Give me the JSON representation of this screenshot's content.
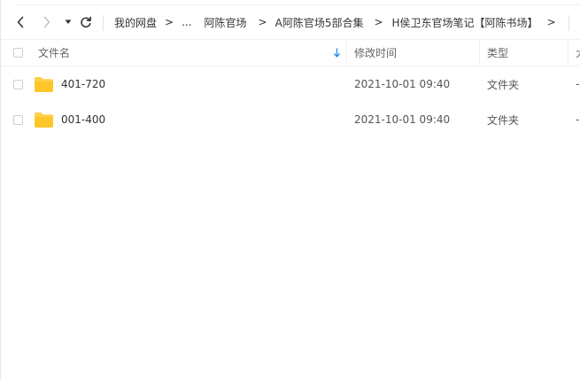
{
  "breadcrumb": {
    "items": [
      "我的网盘",
      "...",
      "阿陈官场",
      "A阿陈官场5部合集",
      "H侯卫东官场笔记【阿陈书场】"
    ],
    "separator": ">"
  },
  "columns": {
    "name": "文件名",
    "modified": "修改时间",
    "type": "类型",
    "size": "大"
  },
  "files": [
    {
      "name": "401-720",
      "modified": "2021-10-01 09:40",
      "type": "文件夹",
      "size": "-"
    },
    {
      "name": "001-400",
      "modified": "2021-10-01 09:40",
      "type": "文件夹",
      "size": "-"
    }
  ],
  "icons": {
    "back": "chevron-left-icon",
    "forward": "chevron-right-icon",
    "history": "caret-down-icon",
    "refresh": "refresh-icon",
    "folder": "folder-icon",
    "sort": "sort-down-arrow-icon"
  },
  "colors": {
    "folder": "#FFD04B",
    "sort_arrow": "#2F8DEB"
  }
}
